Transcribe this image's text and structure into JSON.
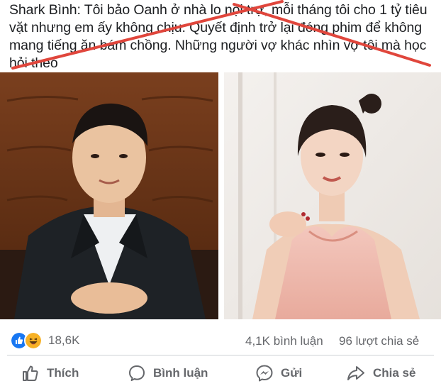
{
  "post": {
    "text": "Shark Bình: Tôi bảo Oanh ở nhà lo nội trợ, mỗi tháng tôi cho 1 tỷ tiêu vặt nhưng em ấy không chịu. Quyết định trở lại đóng phim để không mang tiếng ăn bám chồng. Những người vợ khác nhìn vợ tôi mà học hỏi theo"
  },
  "photos": [
    {
      "subject": "man in suit photo"
    },
    {
      "subject": "woman in pink dress photo"
    }
  ],
  "stats": {
    "reactions_icons": [
      "like-icon",
      "haha-icon"
    ],
    "reactions_count": "18,6K",
    "comments": "4,1K bình luận",
    "shares": "96 lượt chia sẻ"
  },
  "actions": {
    "like": "Thích",
    "comment": "Bình luận",
    "send": "Gửi",
    "share": "Chia sẻ"
  },
  "colors": {
    "strike": "#e0463c",
    "like_blue": "#1877f2",
    "haha_yellow": "#f7b125",
    "muted_text": "#65676b"
  }
}
